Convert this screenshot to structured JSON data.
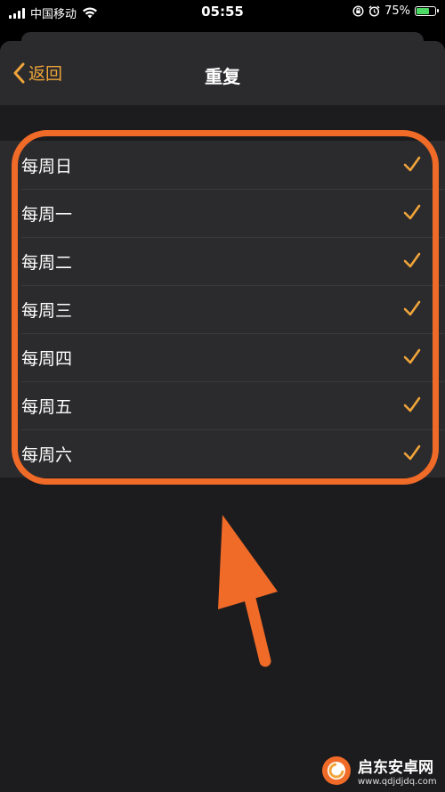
{
  "status_bar": {
    "carrier": "中国移动",
    "time": "05:55",
    "battery": "75%",
    "battery_level": 0.75
  },
  "navbar": {
    "back_label": "返回",
    "title": "重复"
  },
  "days": [
    {
      "label": "每周日",
      "checked": true
    },
    {
      "label": "每周一",
      "checked": true
    },
    {
      "label": "每周二",
      "checked": true
    },
    {
      "label": "每周三",
      "checked": true
    },
    {
      "label": "每周四",
      "checked": true
    },
    {
      "label": "每周五",
      "checked": true
    },
    {
      "label": "每周六",
      "checked": true
    }
  ],
  "colors": {
    "accent": "#f0a43a",
    "annotation": "#f06a28",
    "background": "#1c1c1e",
    "row": "#2b2b2d"
  },
  "watermark": {
    "name": "启东安卓网",
    "url": "www.qdjdjdq.com"
  }
}
